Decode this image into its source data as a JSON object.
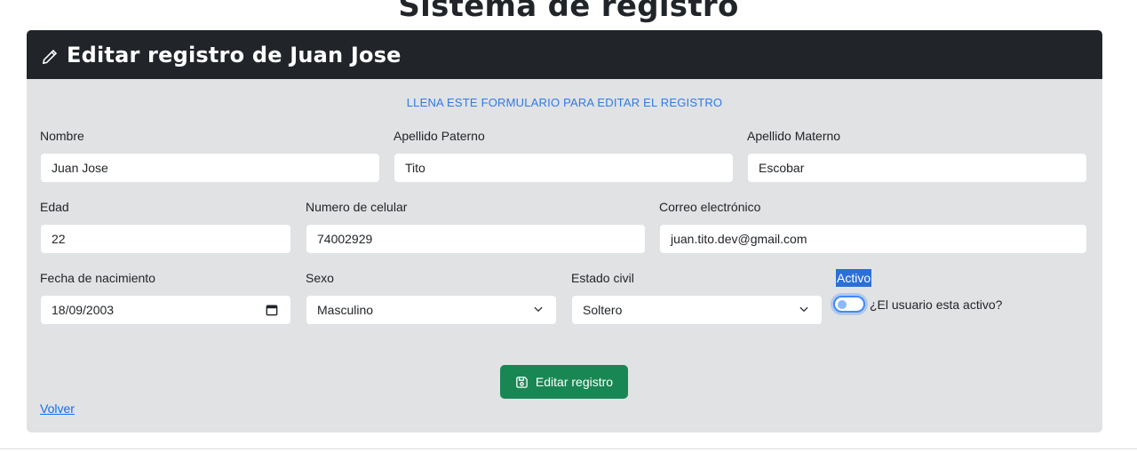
{
  "page_title": "Sistema de registro",
  "card": {
    "title": "Editar registro de Juan Jose",
    "header_icon": "pencil-icon",
    "subtitle": "LLENA ESTE FORMULARIO PARA EDITAR EL REGISTRO"
  },
  "form": {
    "nombre": {
      "label": "Nombre",
      "value": "Juan Jose"
    },
    "apellido_paterno": {
      "label": "Apellido Paterno",
      "value": "Tito"
    },
    "apellido_materno": {
      "label": "Apellido Materno",
      "value": "Escobar"
    },
    "edad": {
      "label": "Edad",
      "value": "22"
    },
    "celular": {
      "label": "Numero de celular",
      "value": "74002929"
    },
    "correo": {
      "label": "Correo electrónico",
      "value": "juan.tito.dev@gmail.com"
    },
    "fecha_nacimiento": {
      "label": "Fecha de nacimiento",
      "value": "18/09/2003",
      "icon": "calendar-icon"
    },
    "sexo": {
      "label": "Sexo",
      "value": "Masculino"
    },
    "estado_civil": {
      "label": "Estado civil",
      "value": "Soltero"
    },
    "activo": {
      "label": "Activo",
      "switch_label": "¿El usuario esta activo?",
      "checked": false
    }
  },
  "actions": {
    "submit_label": "Editar registro",
    "submit_icon": "save-icon",
    "back_label": "Volver"
  },
  "colors": {
    "header_bg": "#212529",
    "card_bg": "#e1e2e4",
    "subtitle": "#2f7be8",
    "submit_bg": "#198754",
    "link": "#0d6efd",
    "switch_border": "#3d8bfd"
  }
}
